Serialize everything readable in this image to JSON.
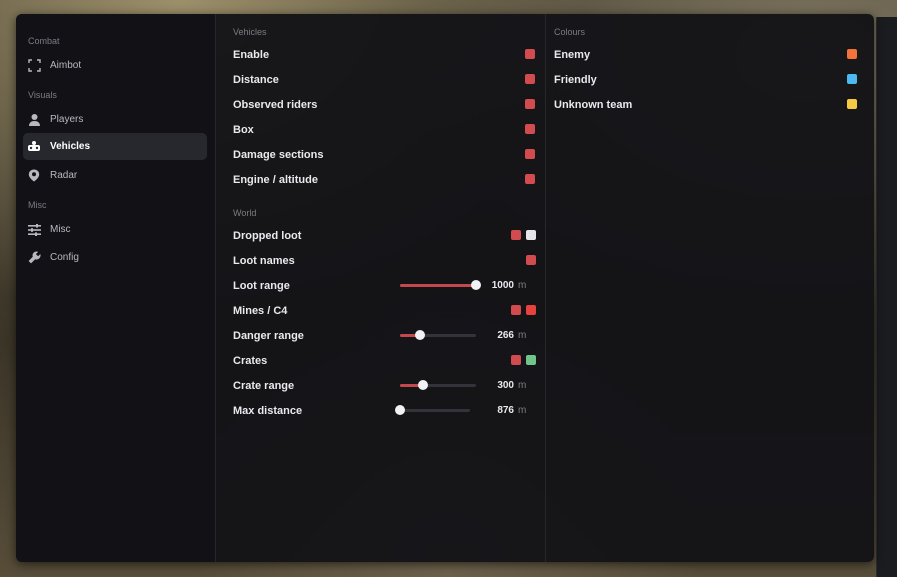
{
  "sidebar": {
    "sections": [
      {
        "label": "Combat"
      },
      {
        "label": "Visuals"
      },
      {
        "label": "Misc"
      }
    ],
    "items": [
      {
        "label": "Aimbot",
        "icon": "crosshair-icon"
      },
      {
        "label": "Players",
        "icon": "person-icon"
      },
      {
        "label": "Vehicles",
        "icon": "vehicle-icon",
        "active": true
      },
      {
        "label": "Radar",
        "icon": "radar-icon"
      },
      {
        "label": "Misc",
        "icon": "sliders-icon"
      },
      {
        "label": "Config",
        "icon": "wrench-icon"
      }
    ]
  },
  "vehicles": {
    "heading": "Vehicles",
    "rows": [
      {
        "label": "Enable",
        "color": "#d24b4f"
      },
      {
        "label": "Distance",
        "color": "#d24b4f"
      },
      {
        "label": "Observed riders",
        "color": "#d24b4f"
      },
      {
        "label": "Box",
        "color": "#d24b4f"
      },
      {
        "label": "Damage sections",
        "color": "#d24b4f"
      },
      {
        "label": "Engine / altitude",
        "color": "#d24b4f"
      }
    ]
  },
  "world": {
    "heading": "World",
    "dropped_loot": {
      "label": "Dropped loot",
      "colors": [
        "#d24b4f",
        "#e6e6ea"
      ]
    },
    "loot_names": {
      "label": "Loot names",
      "color": "#d24b4f"
    },
    "loot_range": {
      "label": "Loot range",
      "value": "1000",
      "unit": "m",
      "fraction": 1.0
    },
    "mines": {
      "label": "Mines / C4",
      "colors": [
        "#d24b4f",
        "#e8423f"
      ]
    },
    "danger_range": {
      "label": "Danger range",
      "value": "266",
      "unit": "m",
      "fraction": 0.26
    },
    "crates": {
      "label": "Crates",
      "colors": [
        "#d24b4f",
        "#71c48c"
      ]
    },
    "crate_range": {
      "label": "Crate range",
      "value": "300",
      "unit": "m",
      "fraction": 0.3
    },
    "max_distance": {
      "label": "Max distance",
      "value": "876",
      "unit": "m",
      "fraction": 0.0
    }
  },
  "colours": {
    "heading": "Colours",
    "rows": [
      {
        "label": "Enemy",
        "color": "#f3733a"
      },
      {
        "label": "Friendly",
        "color": "#4cb9f0"
      },
      {
        "label": "Unknown team",
        "color": "#f6c944"
      }
    ]
  }
}
